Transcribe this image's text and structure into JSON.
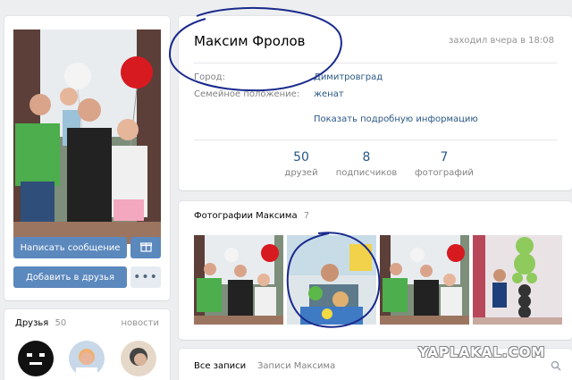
{
  "profile": {
    "name": "Максим Фролов",
    "last_seen": "заходил вчера в 18:08",
    "info": [
      {
        "label": "Город:",
        "value": "Димитровград"
      },
      {
        "label": "Семейное положение:",
        "value": "женат"
      }
    ],
    "more_info_link": "Показать подробную информацию",
    "counters": [
      {
        "num": "50",
        "label": "друзей"
      },
      {
        "num": "8",
        "label": "подписчиков"
      },
      {
        "num": "7",
        "label": "фотографий"
      }
    ]
  },
  "actions": {
    "write_message": "Написать сообщение",
    "add_friend": "Добавить в друзья",
    "gift_icon": "gift-icon",
    "more_icon": "more-icon"
  },
  "photos": {
    "title": "Фотографии Максима",
    "count": "7"
  },
  "friends": {
    "title": "Друзья",
    "count": "50",
    "news_link": "новости"
  },
  "wall": {
    "tabs": [
      "Все записи",
      "Записи Максима"
    ],
    "search_icon": "search-icon"
  },
  "watermark": "YAPLAKAL.COM",
  "colors": {
    "accent": "#5b88bd",
    "link": "#2a5885",
    "annotation": "#1a2a8c"
  }
}
